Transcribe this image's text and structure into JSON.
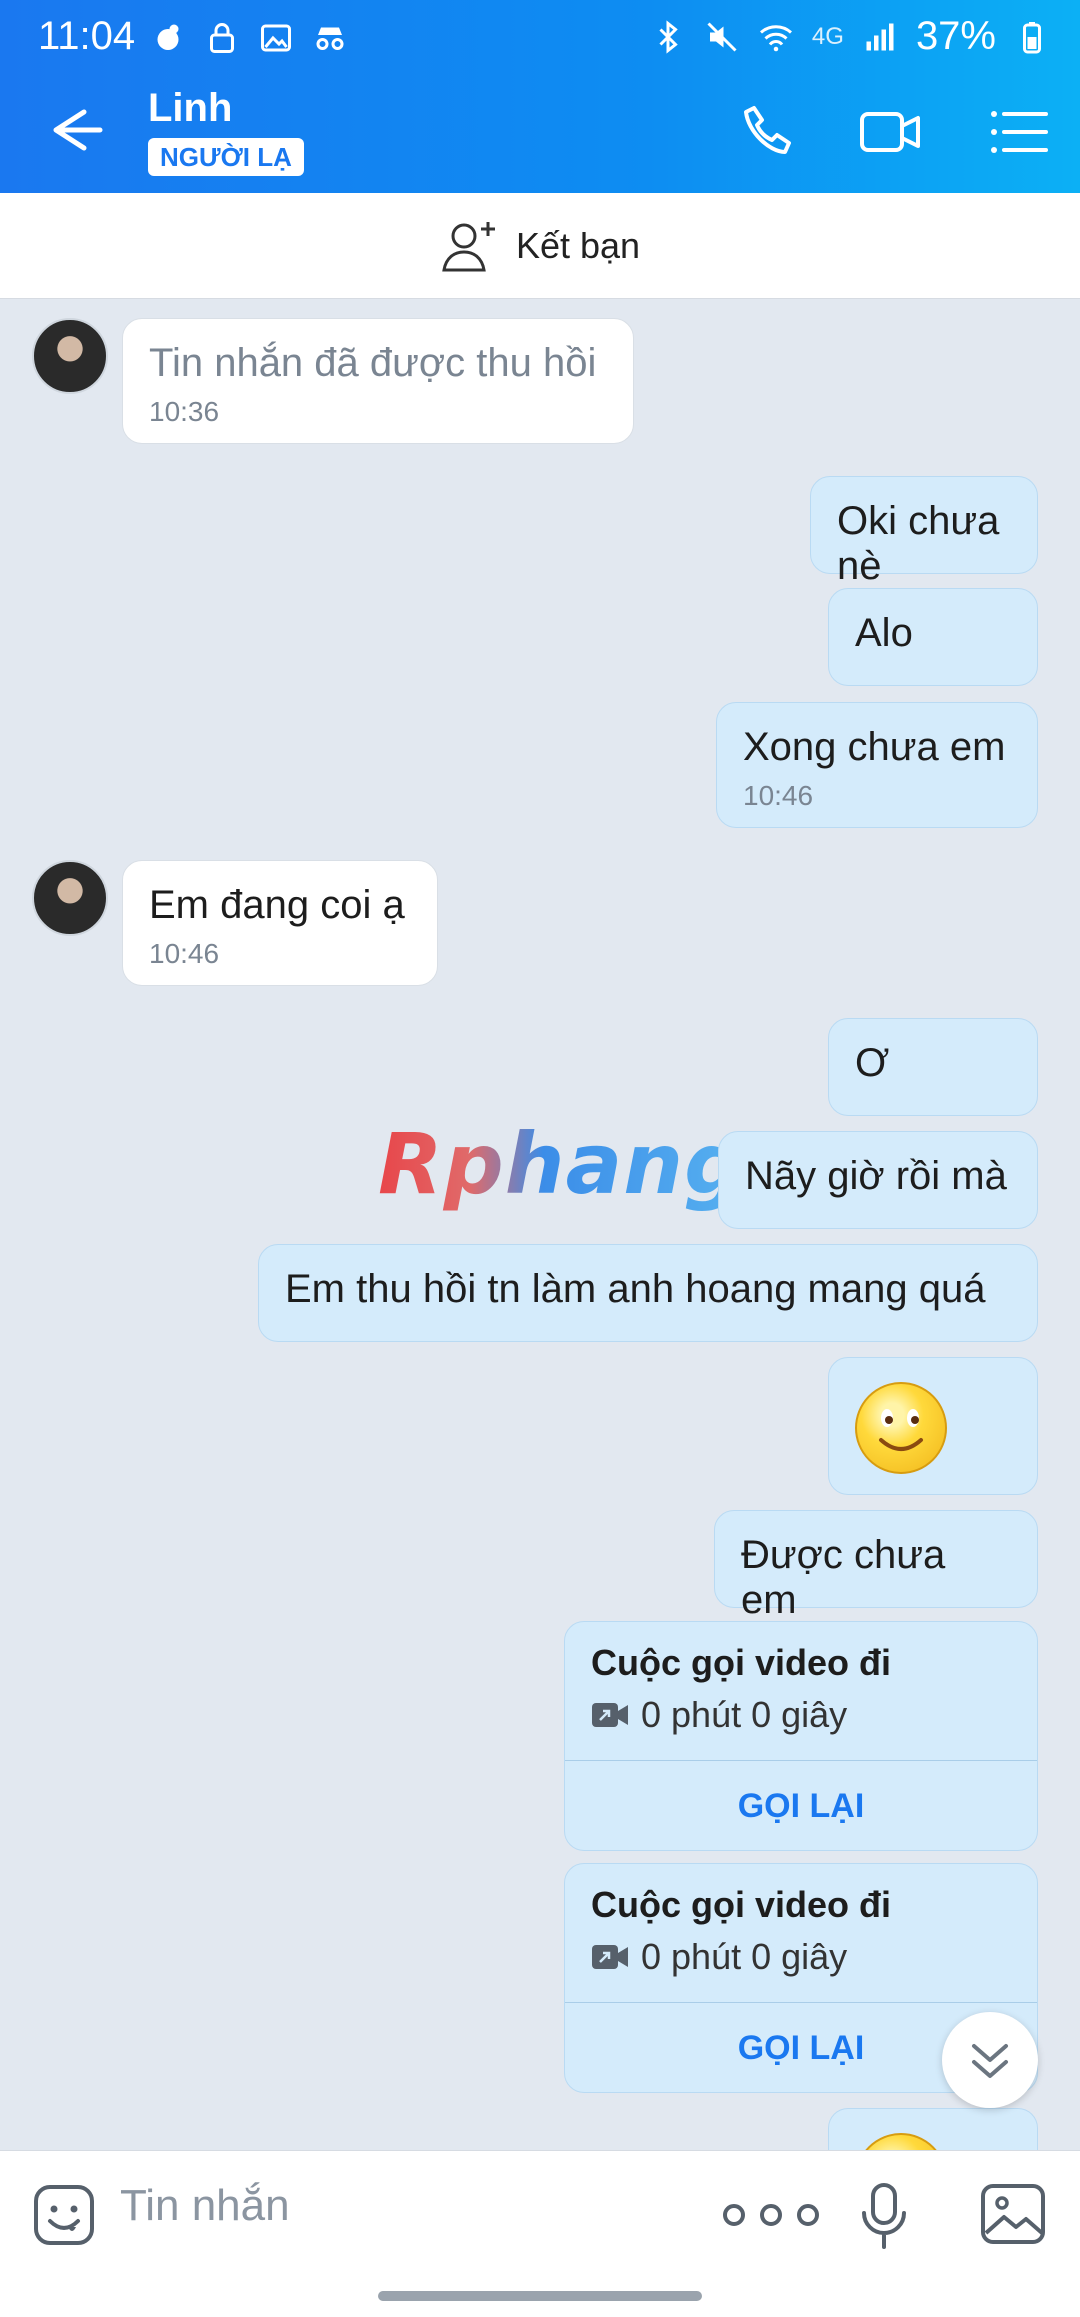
{
  "status_bar": {
    "time": "11:04",
    "battery": "37%",
    "network": "4G"
  },
  "header": {
    "contact_name": "Linh",
    "badge": "NGƯỜI LẠ"
  },
  "friend_bar": {
    "label": "Kết bạn"
  },
  "messages": [
    {
      "side": "in",
      "text": "Tin nhắn đã được thu hồi",
      "time": "10:36",
      "recalled": true
    },
    {
      "side": "out",
      "text": "Oki chưa nè"
    },
    {
      "side": "out",
      "text": "Alo"
    },
    {
      "side": "out",
      "text": "Xong chưa em",
      "time": "10:46"
    },
    {
      "side": "in",
      "text": "Em đang coi ạ",
      "time": "10:46"
    },
    {
      "side": "out",
      "text": "Ơ"
    },
    {
      "side": "out",
      "text": "Nãy giờ rồi mà"
    },
    {
      "side": "out",
      "text": "Em thu hồi tn làm anh hoang mang quá"
    },
    {
      "side": "out",
      "text": "Được chưa em"
    }
  ],
  "calls": [
    {
      "title": "Cuộc gọi video đi",
      "duration": "0 phút 0 giây",
      "action": "GỌI LẠI"
    },
    {
      "title": "Cuộc gọi video đi",
      "duration": "0 phút 0 giây",
      "action": "GỌI LẠI"
    }
  ],
  "watermark": "Rphang",
  "composer": {
    "placeholder": "Tin nhắn"
  },
  "colors": {
    "header_start": "#1a78f0",
    "header_end": "#0cb0f5",
    "outgoing_bubble": "#d4ebfb",
    "background": "#e2e8f0"
  }
}
